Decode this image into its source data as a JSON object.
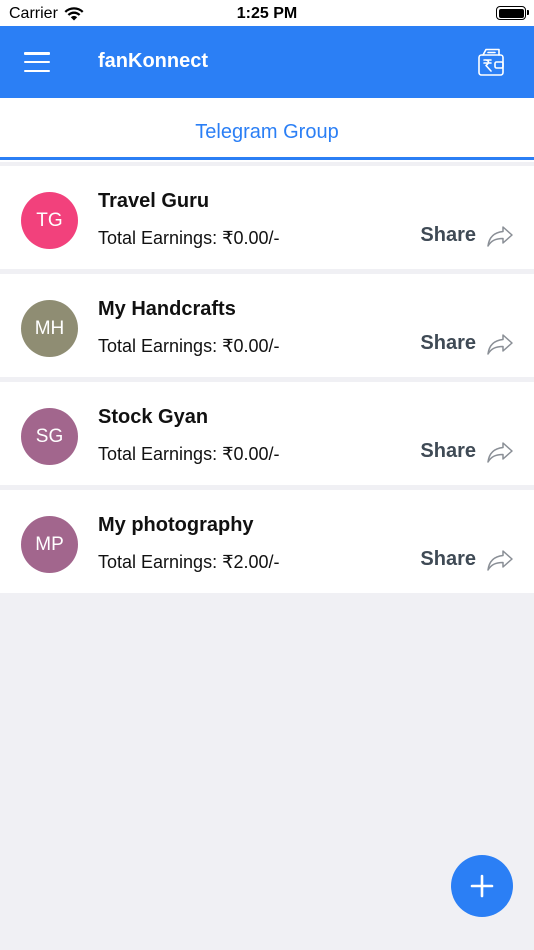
{
  "status_bar": {
    "carrier": "Carrier",
    "time": "1:25 PM"
  },
  "app_bar": {
    "title": "fanKonnect",
    "menu_icon": "hamburger-menu-icon",
    "wallet_icon": "rupee-wallet-icon",
    "background": "#2b7ff5"
  },
  "tabs": [
    {
      "label": "Telegram Group",
      "active": true
    }
  ],
  "groups": [
    {
      "initials": "TG",
      "name": "Travel Guru",
      "earnings": "Total Earnings: ₹0.00/-",
      "share_label": "Share",
      "avatar_color": "#f2417c"
    },
    {
      "initials": "MH",
      "name": "My Handcrafts",
      "earnings": "Total Earnings: ₹0.00/-",
      "share_label": "Share",
      "avatar_color": "#8f8d73"
    },
    {
      "initials": "SG",
      "name": "Stock Gyan",
      "earnings": "Total Earnings: ₹0.00/-",
      "share_label": "Share",
      "avatar_color": "#a2668d"
    },
    {
      "initials": "MP",
      "name": "My photography",
      "earnings": "Total Earnings: ₹2.00/-",
      "share_label": "Share",
      "avatar_color": "#a2668d"
    }
  ],
  "fab": {
    "icon": "plus-icon",
    "color": "#2b7ff5"
  }
}
